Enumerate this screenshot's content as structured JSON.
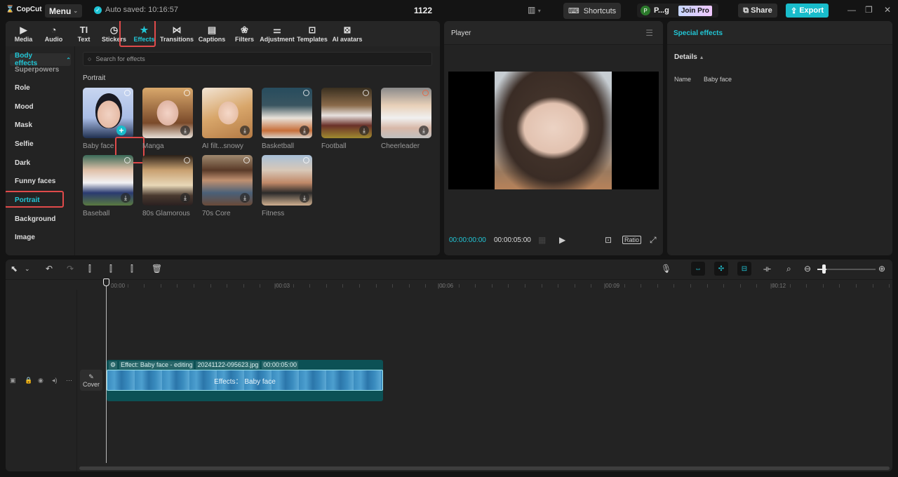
{
  "app": {
    "logo": "CopCut",
    "menu_label": "Menu",
    "autosave": "Auto saved: 10:16:57",
    "project_title": "1122",
    "shortcuts_label": "Shortcuts",
    "user": {
      "initial": "P",
      "name": "P...g"
    },
    "join_pro_label": "Join Pro",
    "share_label": "Share",
    "export_label": "Export",
    "accent_color": "#19bccb"
  },
  "media_tabs": [
    {
      "label": "Media",
      "icon": "media-icon"
    },
    {
      "label": "Audio",
      "icon": "audio-icon"
    },
    {
      "label": "Text",
      "icon": "text-icon"
    },
    {
      "label": "Stickers",
      "icon": "sticker-icon"
    },
    {
      "label": "Effects",
      "icon": "effects-icon",
      "active": true
    },
    {
      "label": "Transitions",
      "icon": "transitions-icon"
    },
    {
      "label": "Captions",
      "icon": "captions-icon"
    },
    {
      "label": "Filters",
      "icon": "filters-icon"
    },
    {
      "label": "Adjustment",
      "icon": "adjustment-icon"
    },
    {
      "label": "Templates",
      "icon": "templates-icon"
    },
    {
      "label": "AI avatars",
      "icon": "ai-avatars-icon"
    }
  ],
  "sidebar": {
    "header": "Body effects",
    "items": [
      {
        "label": "Superpowers"
      },
      {
        "label": "Role"
      },
      {
        "label": "Mood"
      },
      {
        "label": "Mask"
      },
      {
        "label": "Selfie"
      },
      {
        "label": "Dark"
      },
      {
        "label": "Funny faces"
      },
      {
        "label": "Portrait",
        "active": true
      },
      {
        "label": "Background"
      },
      {
        "label": "Image"
      }
    ]
  },
  "effects": {
    "search_placeholder": "Search for effects",
    "section": "Portrait",
    "items": [
      {
        "label": "Baby face",
        "state": "added"
      },
      {
        "label": "Manga",
        "state": "download"
      },
      {
        "label": "AI filt...snowy",
        "state": "download"
      },
      {
        "label": "Basketball",
        "state": "download"
      },
      {
        "label": "Football",
        "state": "download"
      },
      {
        "label": "Cheerleader",
        "state": "download"
      },
      {
        "label": "Baseball",
        "state": "download"
      },
      {
        "label": "80s Glamorous",
        "state": "download"
      },
      {
        "label": "70s Core",
        "state": "download"
      },
      {
        "label": "Fitness",
        "state": "download"
      }
    ]
  },
  "player": {
    "title": "Player",
    "current_time": "00:00:00:00",
    "duration": "00:00:05:00",
    "ratio_label": "Ratio"
  },
  "details": {
    "title": "Special effects",
    "section": "Details",
    "name_key": "Name",
    "name_value": "Baby face"
  },
  "timeline": {
    "ruler": [
      "00:00",
      "|00:03",
      "|00:06",
      "|00:09",
      "|00:12"
    ],
    "cover_label": "Cover",
    "clip": {
      "effect_tag": "Effect: Baby face - editing",
      "file": "20241122-095623.jpg",
      "duration": "00:00:05:00",
      "label": "Effects： Baby face"
    },
    "zoom_level": 0.1
  }
}
